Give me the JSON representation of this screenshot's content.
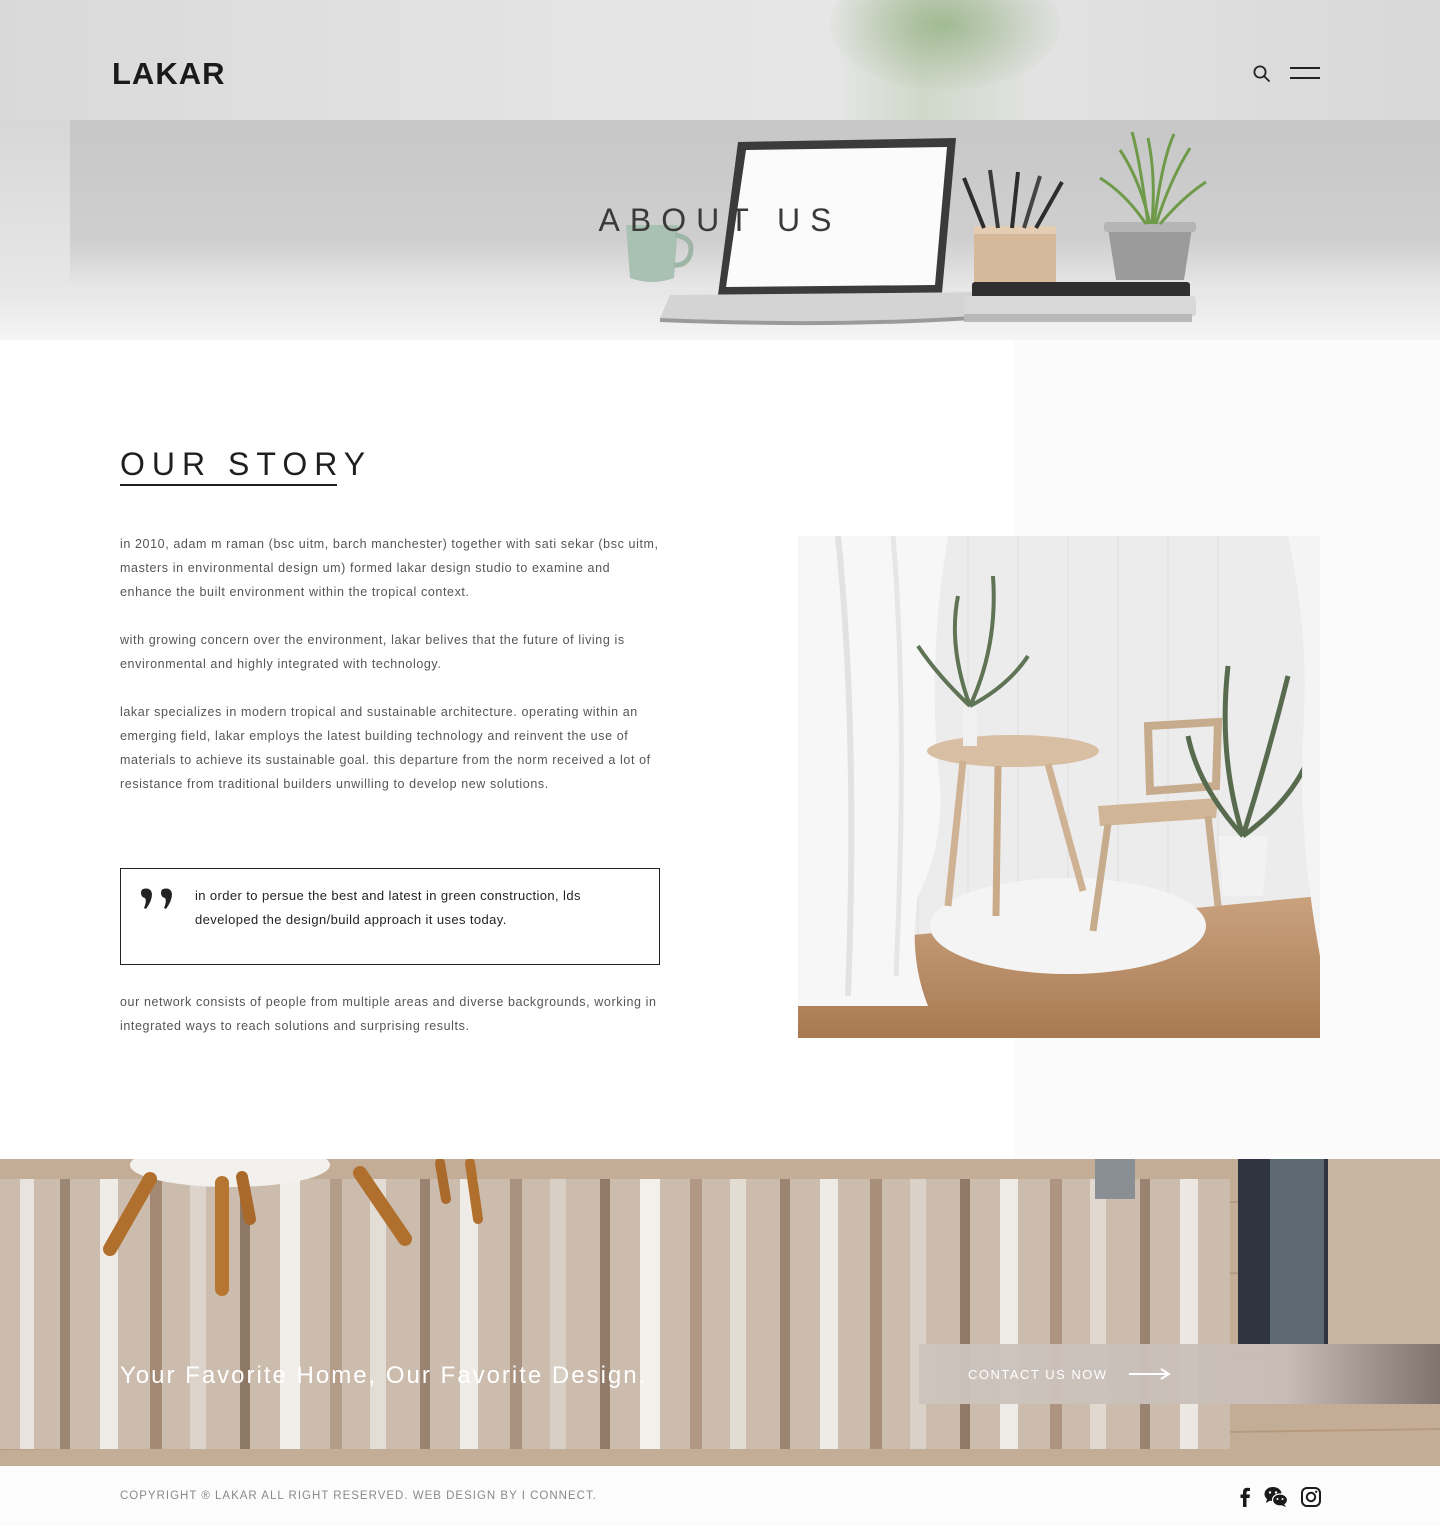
{
  "header": {
    "logo": "LAKAR",
    "search_icon": "search-icon",
    "menu_icon": "hamburger-menu-icon"
  },
  "hero": {
    "title": "ABOUT US"
  },
  "story": {
    "title": "OUR STORY",
    "paragraphs": [
      "in 2010, adam m raman (bsc uitm, barch manchester) together with sati sekar (bsc uitm, masters in environmental design um) formed lakar design studio to examine and enhance the built environment within the tropical context.",
      "with growing concern over the environment, lakar belives that the future of living is environmental and highly integrated with technology.",
      "lakar specializes in modern tropical and sustainable architecture. operating within an emerging field, lakar employs the latest building technology and reinvent the use of materials to achieve its sustainable goal. this departure from the norm received a lot of resistance from traditional builders unwilling to develop new solutions.",
      "our network consists of people from multiple areas and diverse backgrounds, working in integrated ways to reach solutions and surprising results."
    ],
    "quote": "in order to persue the best and latest in green construction, lds developed the design/build approach it uses today.",
    "quote_icon": "quote-icon"
  },
  "banner": {
    "tagline": "Your Favorite Home, Our Favorite Design.",
    "contact_label": "CONTACT US NOW",
    "arrow_icon": "arrow-right-icon"
  },
  "footer": {
    "copyright": "COPYRIGHT ® LAKAR ALL RIGHT RESERVED. WEB DESIGN BY I CONNECT.",
    "social": [
      "facebook-icon",
      "wechat-icon",
      "instagram-icon"
    ]
  },
  "colors": {
    "text_dark": "#1f1f1f",
    "text_body": "#555555",
    "footer_text": "#8a8a8a",
    "button_bg": "#cdc4be"
  }
}
